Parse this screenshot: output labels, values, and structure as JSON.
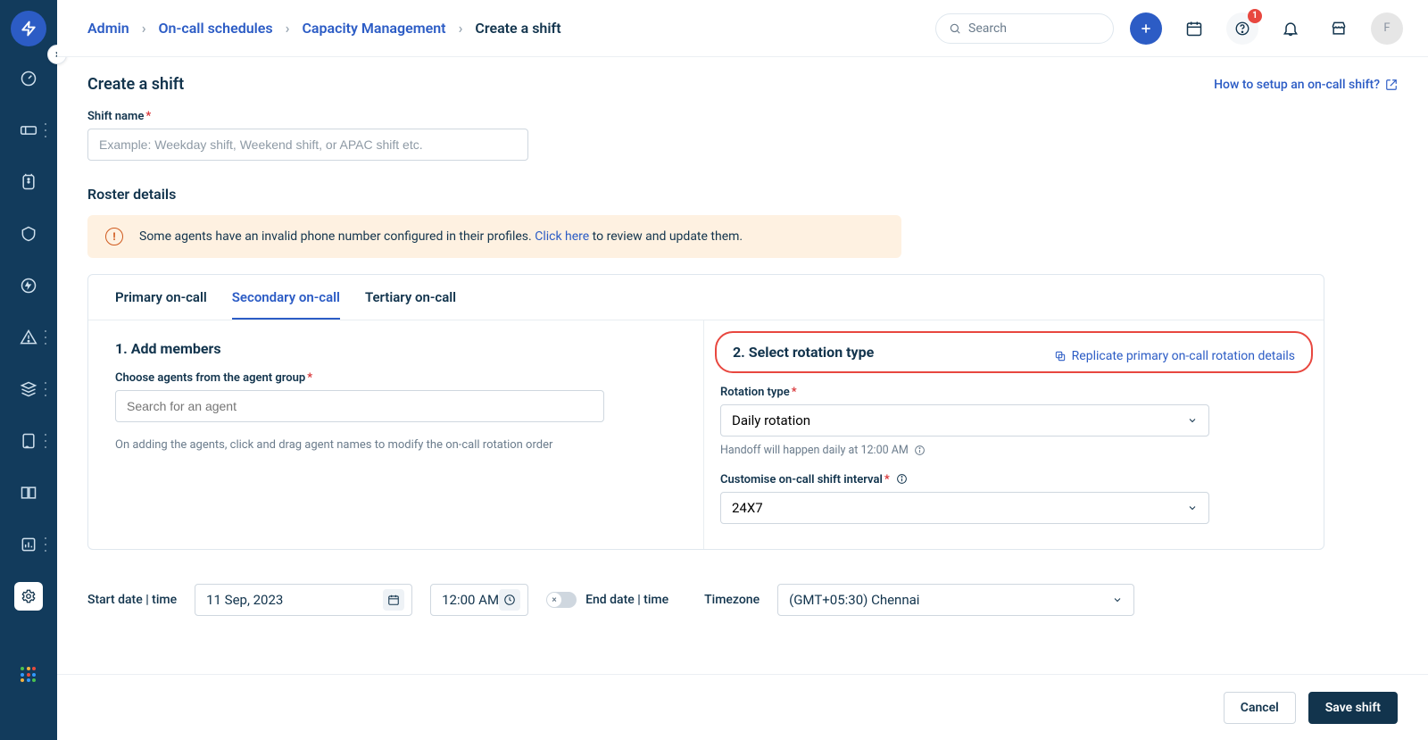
{
  "header": {
    "breadcrumb": [
      "Admin",
      "On-call schedules",
      "Capacity Management",
      "Create a shift"
    ],
    "search_placeholder": "Search",
    "notification_badge": "1",
    "avatar_initial": "F"
  },
  "page": {
    "title": "Create a shift",
    "help_link": "How to setup an on-call shift?"
  },
  "shift_name": {
    "label": "Shift name",
    "placeholder": "Example: Weekday shift, Weekend shift, or APAC shift etc.",
    "value": ""
  },
  "roster": {
    "title": "Roster details",
    "alert_prefix": "Some agents have an invalid phone number configured in their profiles. ",
    "alert_link": "Click here",
    "alert_suffix": " to review and update them."
  },
  "tabs": {
    "primary": "Primary on-call",
    "secondary": "Secondary on-call",
    "tertiary": "Tertiary on-call"
  },
  "add_members": {
    "title": "1. Add members",
    "choose_label": "Choose agents from the agent group",
    "search_placeholder": "Search for an agent",
    "hint": "On adding the agents, click and drag agent names to modify the on-call rotation order"
  },
  "rotation": {
    "title": "2. Select rotation type",
    "replicate_link": "Replicate primary on-call rotation details",
    "type_label": "Rotation type",
    "type_value": "Daily rotation",
    "handoff_hint": "Handoff will happen daily at 12:00 AM",
    "interval_label": "Customise on-call shift interval",
    "interval_value": "24X7"
  },
  "datetime": {
    "start_label": "Start date | time",
    "start_date": "11 Sep, 2023",
    "start_time": "12:00 AM",
    "end_label": "End date | time",
    "timezone_label": "Timezone",
    "timezone_value": "(GMT+05:30) Chennai"
  },
  "footer": {
    "cancel": "Cancel",
    "save": "Save shift"
  }
}
